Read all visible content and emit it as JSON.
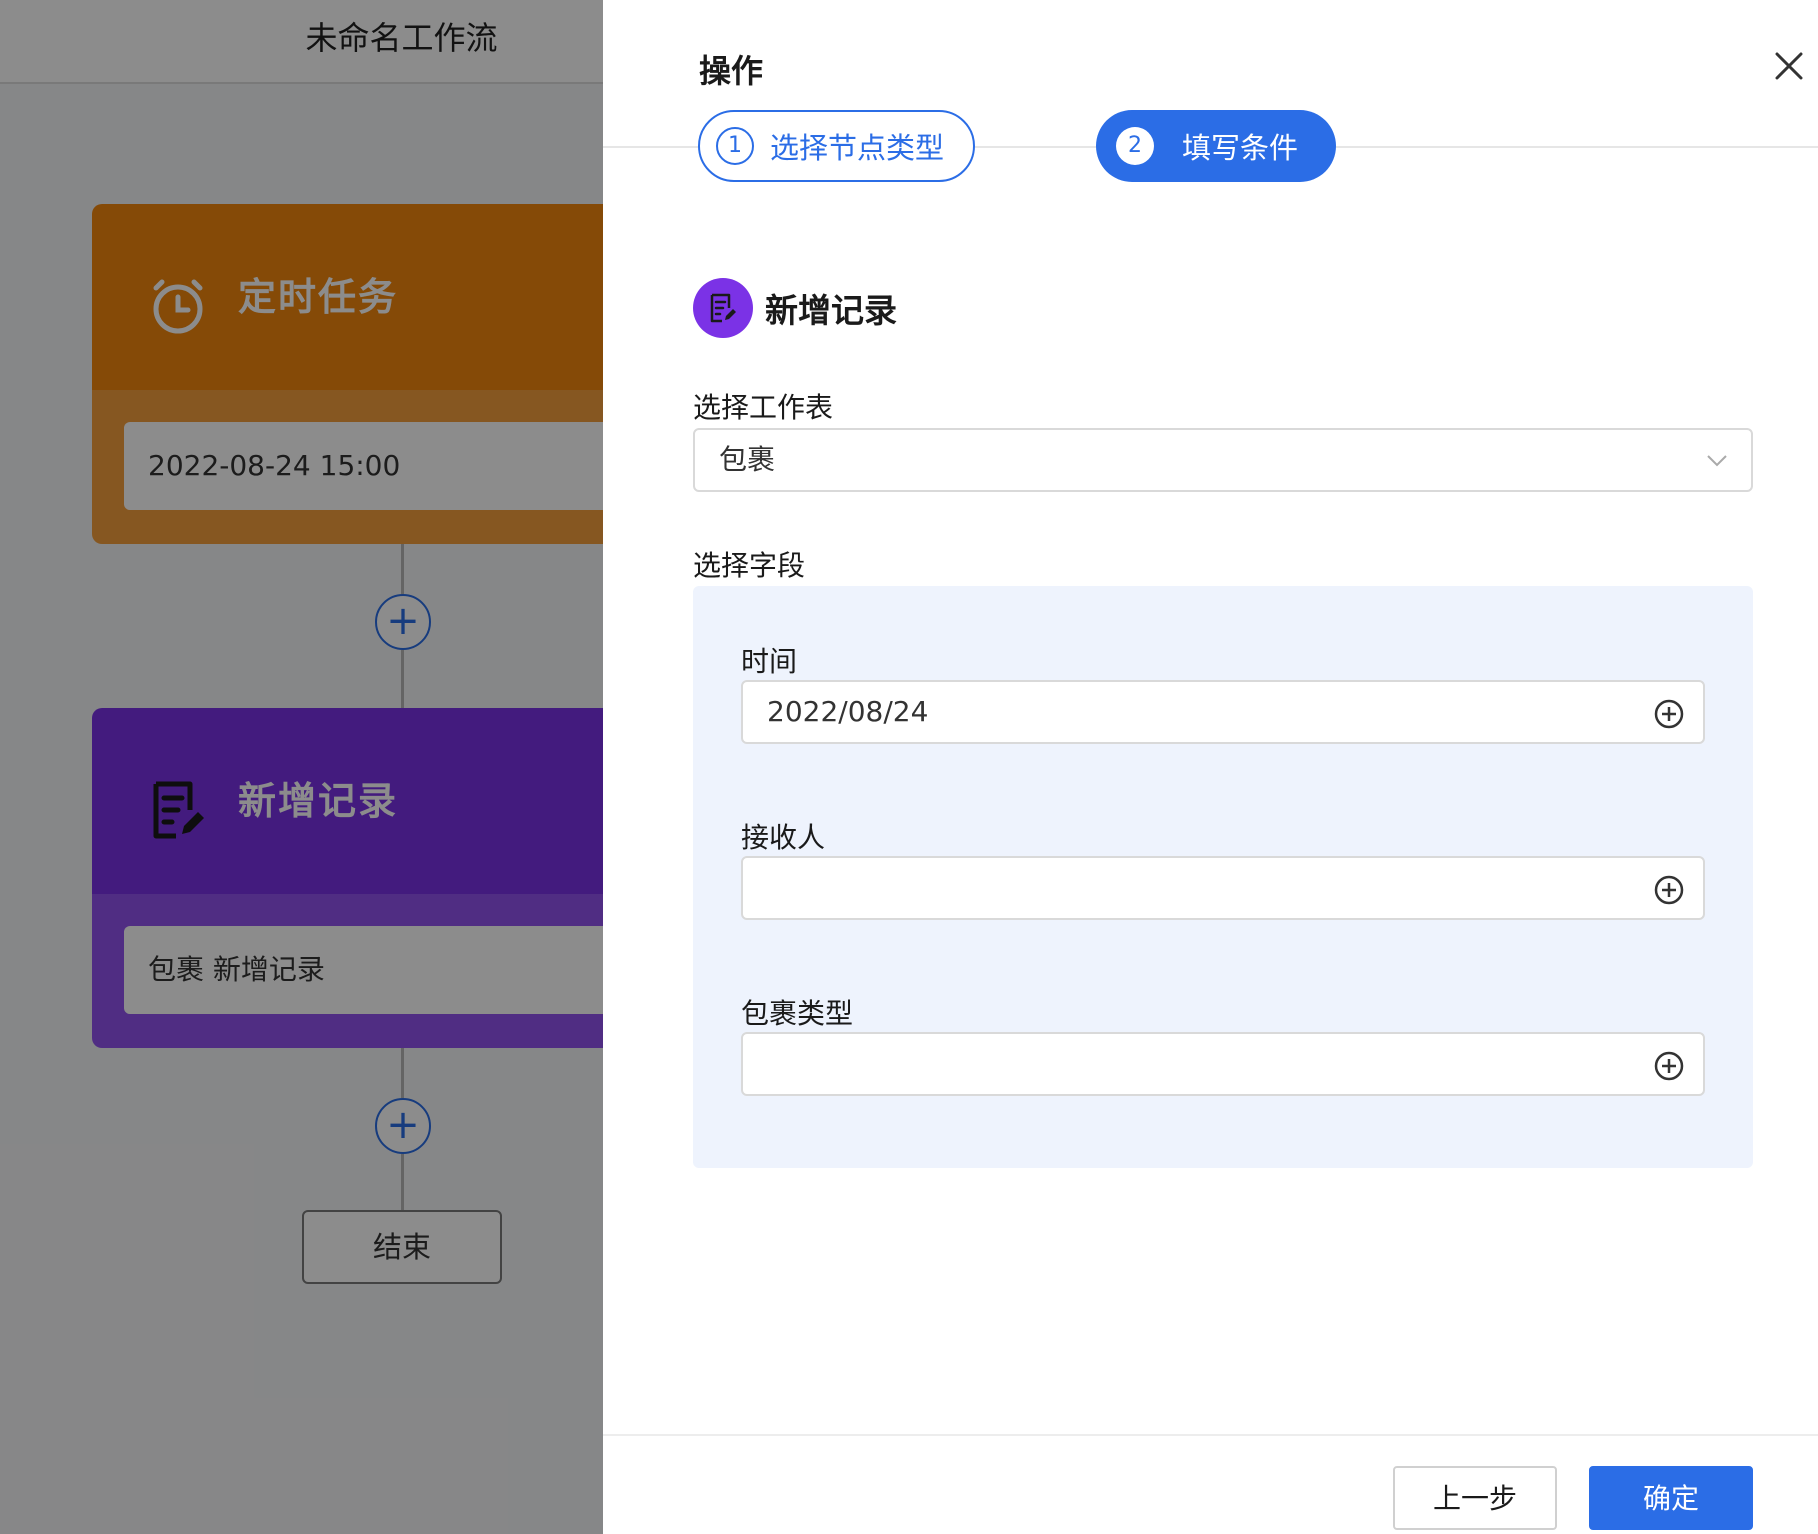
{
  "canvas": {
    "title": "未命名工作流",
    "nodes": [
      {
        "title": "定时任务",
        "value": "2022-08-24 15:00",
        "icon": "alarm-clock-icon"
      },
      {
        "title": "新增记录",
        "value": "包裹 新增记录",
        "icon": "edit-document-icon"
      }
    ],
    "add_symbol": "+",
    "end_label": "结束"
  },
  "drawer": {
    "title": "操作",
    "steps": [
      {
        "number": "1",
        "label": "选择节点类型"
      },
      {
        "number": "2",
        "label": "填写条件"
      }
    ],
    "section_title": "新增记录",
    "worksheet": {
      "label": "选择工作表",
      "value": "包裹"
    },
    "fields_label": "选择字段",
    "fields": [
      {
        "label": "时间",
        "value": "2022/08/24"
      },
      {
        "label": "接收人",
        "value": ""
      },
      {
        "label": "包裹类型",
        "value": ""
      }
    ],
    "buttons": {
      "prev": "上一步",
      "ok": "确定"
    }
  },
  "colors": {
    "primary": "#2b6de6",
    "timer_node": "#f2870e",
    "record_node": "#7b32e6",
    "field_panel": "#eef3fd"
  }
}
